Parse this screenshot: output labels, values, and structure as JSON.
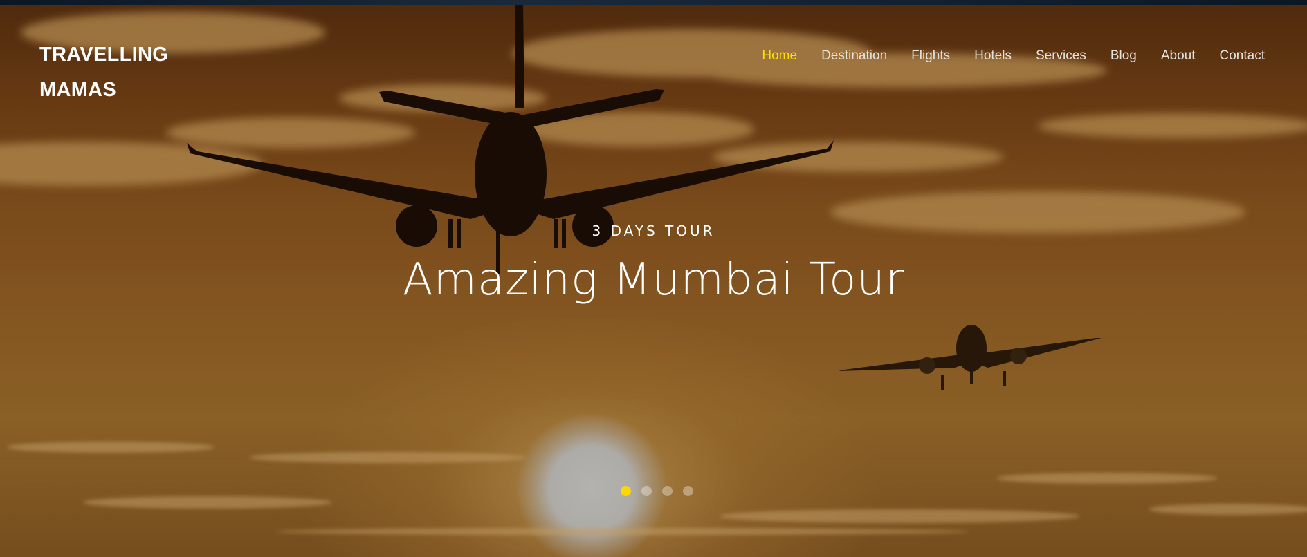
{
  "brand": {
    "line1": "TRAVELLING",
    "line2": "MAMAS"
  },
  "nav": {
    "items": [
      {
        "label": "Home",
        "active": true
      },
      {
        "label": "Destination",
        "active": false
      },
      {
        "label": "Flights",
        "active": false
      },
      {
        "label": "Hotels",
        "active": false
      },
      {
        "label": "Services",
        "active": false
      },
      {
        "label": "Blog",
        "active": false
      },
      {
        "label": "About",
        "active": false
      },
      {
        "label": "Contact",
        "active": false
      }
    ]
  },
  "hero": {
    "eyebrow": "3 DAYS TOUR",
    "headline": "Amazing Mumbai Tour",
    "slides_total": 4,
    "active_slide": 1
  },
  "colors": {
    "accent": "#ffde00",
    "text": "#ffffff",
    "nav_text": "#e6e2dc",
    "sky": "#9c6628"
  },
  "icons": [
    "airplane-silhouette-large",
    "airplane-silhouette-small",
    "sun"
  ]
}
